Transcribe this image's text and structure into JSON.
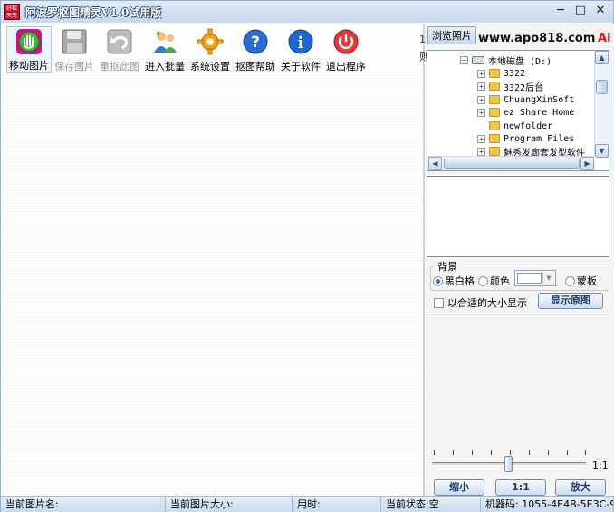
{
  "window": {
    "title": "阿波罗抠图精灵V1.0试用版",
    "app_icon_text": "好软 天天",
    "minimize": "─",
    "maximize": "□",
    "close": "✕"
  },
  "toolbar": [
    {
      "id": "move",
      "label": "移动图片",
      "icon": "hand-icon",
      "enabled": true
    },
    {
      "id": "save",
      "label": "保存图片",
      "icon": "floppy-icon",
      "enabled": false
    },
    {
      "id": "redo",
      "label": "重抠此图",
      "icon": "undo-icon",
      "enabled": false
    },
    {
      "id": "batch",
      "label": "进入批量",
      "icon": "users-icon",
      "enabled": true
    },
    {
      "id": "settings",
      "label": "系统设置",
      "icon": "gear-icon",
      "enabled": true
    },
    {
      "id": "help",
      "label": "抠图帮助",
      "icon": "help-icon",
      "enabled": true
    },
    {
      "id": "about",
      "label": "关于软件",
      "icon": "info-icon",
      "enabled": true
    },
    {
      "id": "exit",
      "label": "退出程序",
      "icon": "power-icon",
      "enabled": true
    }
  ],
  "panel": {
    "tab_label": "浏览照片",
    "site_text": "www.apo818.com",
    "site_tail": "Ai",
    "peek_1": "1",
    "peek_2": "则"
  },
  "tree": {
    "root": "本地磁盘 (D:)",
    "items": [
      {
        "label": "3322",
        "expandable": true
      },
      {
        "label": "3322后台",
        "expandable": true
      },
      {
        "label": "ChuangXinSoft",
        "expandable": true
      },
      {
        "label": "ez Share Home",
        "expandable": true
      },
      {
        "label": "newfolder",
        "expandable": false
      },
      {
        "label": "Program Files",
        "expandable": true
      },
      {
        "label": "魅秀发廊套发型软件",
        "expandable": true
      }
    ]
  },
  "background": {
    "group_label": "背景",
    "options": [
      "黑白格",
      "颜色",
      "蒙板"
    ],
    "selected": "黑白格"
  },
  "fit_checkbox_label": "以合适的大小显示",
  "show_original_button": "显示原图",
  "zoom": {
    "readout": "1:1",
    "shrink_button": "缩小",
    "reset_button": "1:1",
    "enlarge_button": "放大",
    "slider_fraction": 0.5
  },
  "statusbar": {
    "image_name": "当前图片名:",
    "image_size": "当前图片大小:",
    "elapsed": "用时:",
    "state": "当前状态:空",
    "machine_code": "机器码: 1055-4E4B-5E3C-9"
  }
}
